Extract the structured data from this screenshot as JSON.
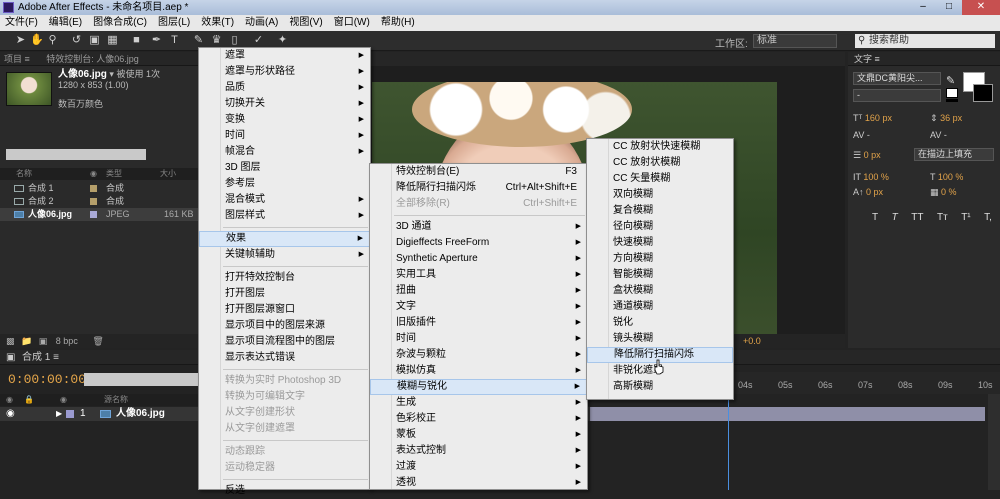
{
  "window": {
    "title": "Adobe After Effects - 未命名项目.aep *"
  },
  "menubar": [
    "文件(F)",
    "编辑(E)",
    "图像合成(C)",
    "图层(L)",
    "效果(T)",
    "动画(A)",
    "视图(V)",
    "窗口(W)",
    "帮助(H)"
  ],
  "toolbar": {
    "workspace_label": "工作区:",
    "workspace_value": "标准",
    "search_placeholder": "搜索帮助"
  },
  "project": {
    "tab_project": "项目 ≡",
    "tab_effects": "特效控制台: 人像06.jpg",
    "item_name": "人像06.jpg",
    "item_used": "▾ 被使用 1次",
    "item_size": "1280 x 853 (1.00)",
    "item_color": "数百万颜色",
    "col_name": "名称",
    "col_type": "类型",
    "col_size": "大小",
    "rows": [
      {
        "name": "合成 1",
        "type": "合成",
        "size": ""
      },
      {
        "name": "合成 2",
        "type": "合成",
        "size": ""
      },
      {
        "name": "人像06.jpg",
        "type": "JPEG",
        "size": "161 KB"
      }
    ],
    "bpc": "8 bpc"
  },
  "viewer": {
    "offset": "+0.0"
  },
  "character": {
    "tab": "文字 ≡",
    "font": "文鼎DC黄阳尖...",
    "font_style": "-",
    "size": "160 px",
    "leading": "36 px",
    "tracking": "-",
    "kerning": "-",
    "stroke_width": "0 px",
    "stroke_mode": "在描边上填充",
    "vscale": "100 %",
    "hscale": "100 %",
    "baseline": "0 px",
    "tsume": "0 %",
    "style_buttons": [
      "T",
      "T",
      "TT",
      "Tт",
      "T¹",
      "T,"
    ]
  },
  "timeline": {
    "tab": "合成 1 ≡",
    "timecode": "0:00:00:00",
    "col_source": "源名称",
    "layer_num": "1",
    "layer_name": "人像06.jpg",
    "ruler": [
      "04s",
      "05s",
      "06s",
      "07s",
      "08s",
      "09s",
      "10s"
    ]
  },
  "context_menu": {
    "items": [
      {
        "label": "遮罩",
        "arrow": true
      },
      {
        "label": "遮罩与形状路径",
        "arrow": true
      },
      {
        "label": "品质",
        "arrow": true
      },
      {
        "label": "切换开关",
        "arrow": true
      },
      {
        "label": "变换",
        "arrow": true
      },
      {
        "label": "时间",
        "arrow": true
      },
      {
        "label": "帧混合",
        "arrow": true
      },
      {
        "label": "3D 图层",
        "arrow": false
      },
      {
        "label": "参考层",
        "arrow": false
      },
      {
        "label": "混合模式",
        "arrow": true
      },
      {
        "label": "图层样式",
        "arrow": true
      },
      {
        "sep": true
      },
      {
        "label": "效果",
        "arrow": true,
        "highlight": true
      },
      {
        "label": "关键帧辅助",
        "arrow": true
      },
      {
        "sep": true
      },
      {
        "label": "打开特效控制台"
      },
      {
        "label": "打开图层"
      },
      {
        "label": "打开图层源窗口"
      },
      {
        "label": "显示项目中的图层来源"
      },
      {
        "label": "显示项目流程图中的图层"
      },
      {
        "label": "显示表达式错误"
      },
      {
        "sep": true
      },
      {
        "label": "转换为实时 Photoshop 3D",
        "disabled": true
      },
      {
        "label": "转换为可编辑文字",
        "disabled": true
      },
      {
        "label": "从文字创建形状",
        "disabled": true
      },
      {
        "label": "从文字创建遮罩",
        "disabled": true
      },
      {
        "sep": true
      },
      {
        "label": "动态跟踪",
        "disabled": true
      },
      {
        "label": "运动稳定器",
        "disabled": true
      },
      {
        "sep": true
      },
      {
        "label": "反选"
      }
    ]
  },
  "effects_menu": {
    "items": [
      {
        "label": "特效控制台(E)",
        "shortcut": "F3"
      },
      {
        "label": "降低隔行扫描闪烁",
        "shortcut": "Ctrl+Alt+Shift+E"
      },
      {
        "label": "全部移除(R)",
        "shortcut": "Ctrl+Shift+E",
        "disabled": true
      },
      {
        "sep": true
      },
      {
        "label": "3D 通道",
        "arrow": true
      },
      {
        "label": "Digieffects FreeForm",
        "arrow": true
      },
      {
        "label": "Synthetic Aperture",
        "arrow": true
      },
      {
        "label": "实用工具",
        "arrow": true
      },
      {
        "label": "扭曲",
        "arrow": true
      },
      {
        "label": "文字",
        "arrow": true
      },
      {
        "label": "旧版插件",
        "arrow": true
      },
      {
        "label": "时间",
        "arrow": true
      },
      {
        "label": "杂波与颗粒",
        "arrow": true
      },
      {
        "label": "模拟仿真",
        "arrow": true
      },
      {
        "label": "模糊与锐化",
        "arrow": true,
        "highlight": true
      },
      {
        "label": "生成",
        "arrow": true
      },
      {
        "label": "色彩校正",
        "arrow": true
      },
      {
        "label": "蒙板",
        "arrow": true
      },
      {
        "label": "表达式控制",
        "arrow": true
      },
      {
        "label": "过渡",
        "arrow": true
      },
      {
        "label": "透视",
        "arrow": true
      }
    ]
  },
  "blur_menu": {
    "items": [
      {
        "label": "CC 放射状快速模糊"
      },
      {
        "label": "CC 放射状模糊"
      },
      {
        "label": "CC 矢量模糊"
      },
      {
        "label": "双向模糊"
      },
      {
        "label": "复合模糊"
      },
      {
        "label": "径向模糊"
      },
      {
        "label": "快速模糊"
      },
      {
        "label": "方向模糊"
      },
      {
        "label": "智能模糊"
      },
      {
        "label": "盒状模糊"
      },
      {
        "label": "通道模糊"
      },
      {
        "label": "锐化"
      },
      {
        "label": "镜头模糊"
      },
      {
        "label": "降低隔行扫描闪烁",
        "highlight": true
      },
      {
        "label": "非锐化遮罩"
      },
      {
        "label": "高斯模糊"
      }
    ]
  }
}
